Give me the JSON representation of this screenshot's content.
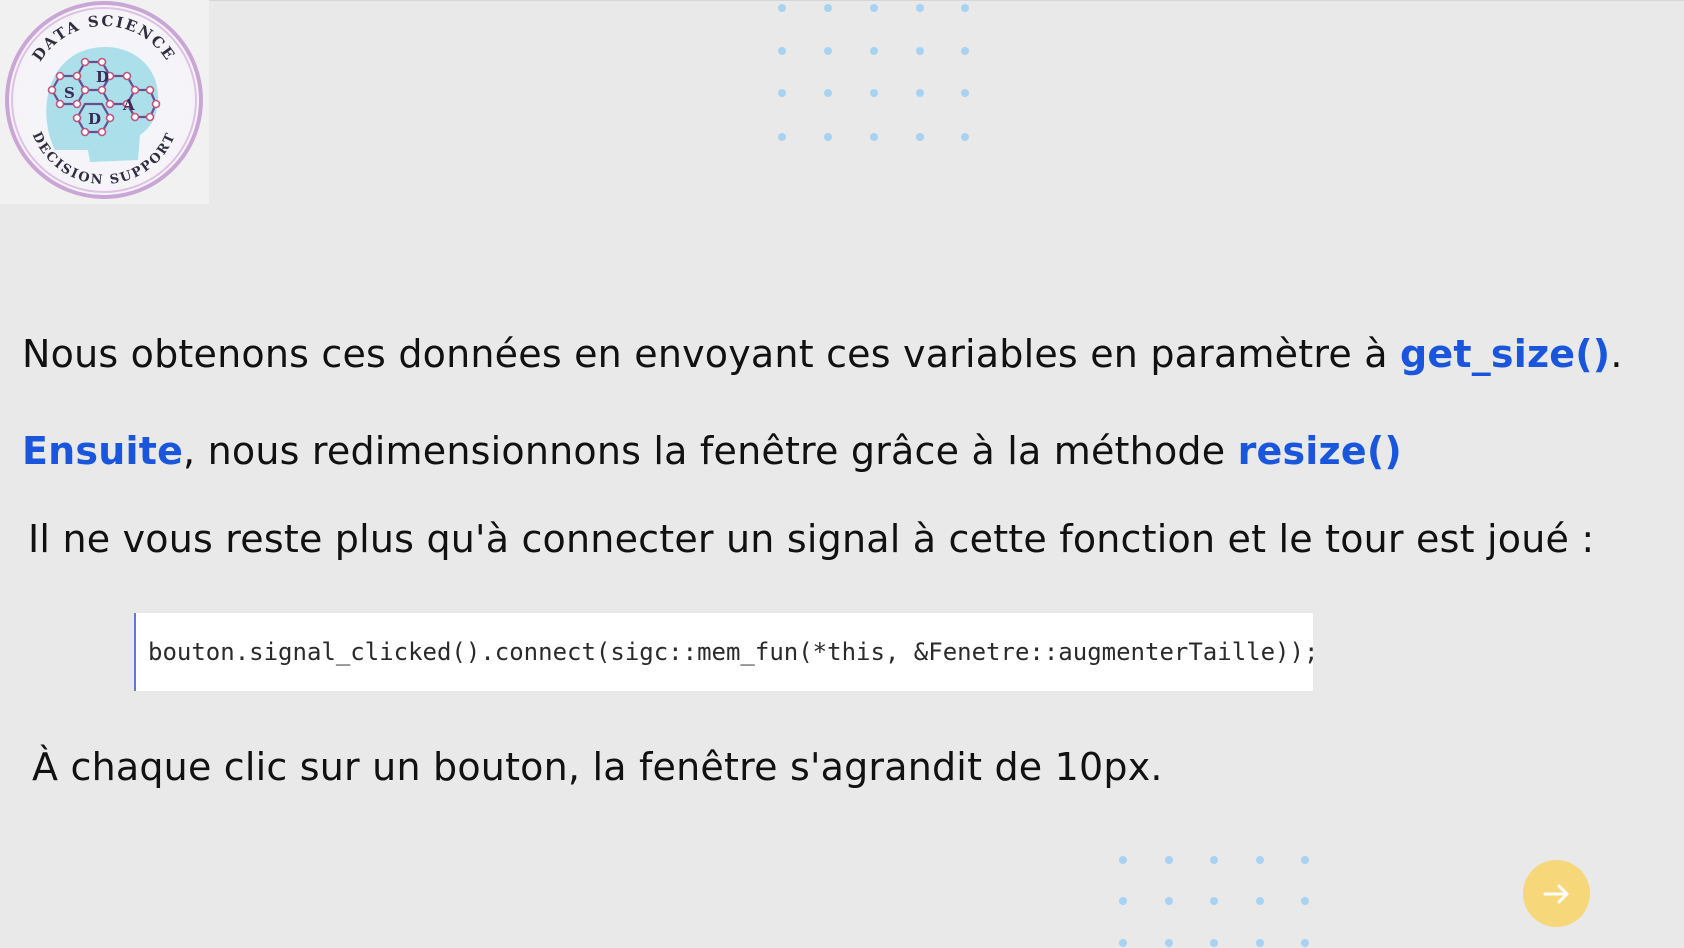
{
  "logo": {
    "top_text": "DATA SCIENCE",
    "bottom_text": "DECISION SUPPORT",
    "letters": [
      "S",
      "D",
      "D",
      "A"
    ]
  },
  "content": {
    "line1_text": "Nous obtenons ces données en envoyant ces variables en paramètre à ",
    "line1_accent": "get_size()",
    "line1_end": ".",
    "line2_accent": "Ensuite",
    "line2_text": ", nous redimensionnons la fenêtre grâce à la méthode ",
    "line2_accent2": "resize()",
    "line3_text": "Il ne vous reste plus qu'à connecter un signal à cette fonction et le tour est joué :",
    "code": "bouton.signal_clicked().connect(sigc::mem_fun(*this, &Fenetre::augmenterTaille));",
    "line4_text": "À chaque clic sur un bouton, la fenêtre s'agrandit de 10px."
  },
  "colors": {
    "background": "#e9e9e9",
    "accent": "#1a56db",
    "dots": "#a8d2f2",
    "next_button": "#f6d77a"
  },
  "icons": {
    "next": "arrow-right-icon"
  }
}
